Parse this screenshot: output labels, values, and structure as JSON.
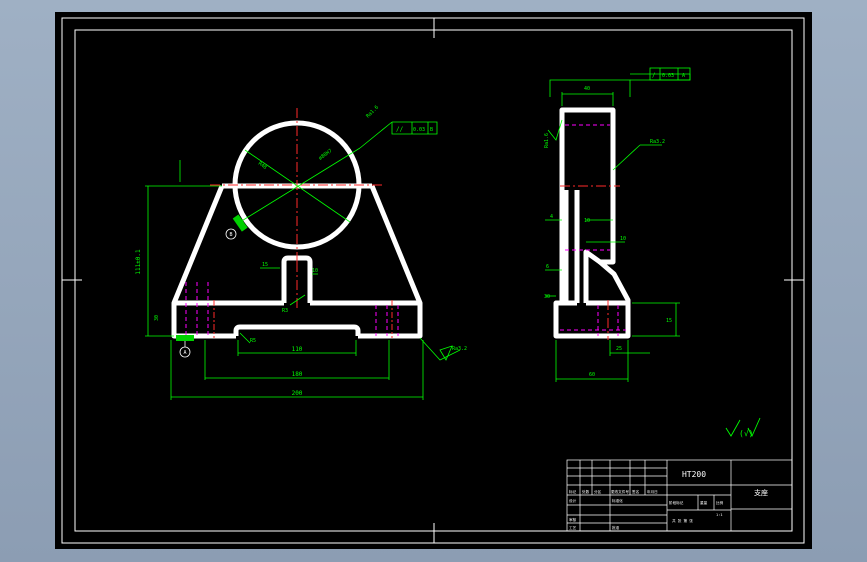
{
  "colors": {
    "background": "#9fb0c4",
    "paper": "#000000",
    "border": "#ffffff",
    "part": "#ffffff",
    "centerline": "#ff2a2a",
    "hidden": "#ff00ff",
    "dimension": "#00ff00",
    "datum_marker": "#00d000"
  },
  "front_view": {
    "datum_label": "A",
    "datum_label_2": "B",
    "dims": {
      "height": "111±0.1",
      "bore": "ø80H7",
      "roughness_top": "Ra1.6",
      "parallel": "0.03",
      "parallel_datum": "B",
      "radius": "R48",
      "rib": "15",
      "rib_w": "10",
      "slot_r": "R3",
      "foot_h": "30",
      "foot_r": "R5",
      "slot_w": "110",
      "hole_span": "180",
      "total_w": "200",
      "roughness_bottom": "Ra3.2"
    }
  },
  "side_view": {
    "dims": {
      "top_w": "40",
      "perp": "0.03",
      "perp_datum": "A",
      "roughness_left": "Ra1.6",
      "roughness_right": "Ra3.2",
      "d1": "4",
      "d2": "10",
      "d3": "10",
      "d4": "6",
      "d5": "30",
      "base_h": "15",
      "base_w2": "25",
      "base_w": "60"
    }
  },
  "roughness_note": "(√)",
  "title_block": {
    "title": "支座",
    "material": "HT200",
    "cells": [
      "标记",
      "处数",
      "分区",
      "更改文件号",
      "签名",
      "年月日",
      "设计",
      "标准化",
      "阶段标记",
      "重量",
      "比例",
      "审核",
      "工艺",
      "批准",
      "共 张 第 张",
      "1:1"
    ]
  }
}
